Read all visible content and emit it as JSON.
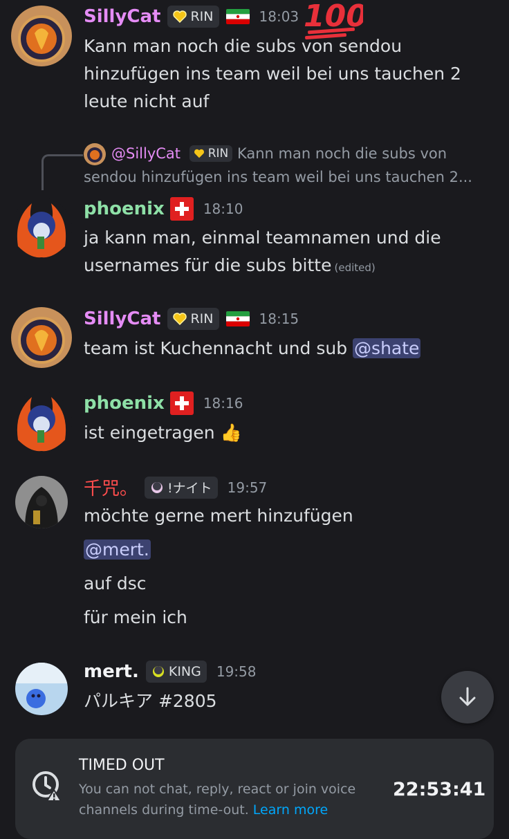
{
  "messages": [
    {
      "author": "SillyCat",
      "tag": "RIN",
      "time": "18:03",
      "lines": [
        "Kann man noch die subs von sendou",
        "hinzufügen ins team weil bei uns tauchen 2",
        "leute nicht auf"
      ]
    },
    {
      "reply": {
        "author": "@SillyCat",
        "tag": "RIN",
        "text_line1": "Kann man noch die subs von",
        "text_line2": "sendou hinzufügen ins team weil bei uns tauchen 2..."
      },
      "author": "phoenix",
      "time": "18:10",
      "lines": [
        "ja kann man, einmal teamnamen und die",
        "usernames für die subs bitte"
      ],
      "edited": "(edited)"
    },
    {
      "author": "SillyCat",
      "tag": "RIN",
      "time": "18:15",
      "text": "team ist Kuchennacht und sub",
      "mention": "@shate"
    },
    {
      "author": "phoenix",
      "time": "18:16",
      "text": "ist eingetragen",
      "emoji": "👍"
    },
    {
      "author": "千咒。",
      "tag": "!ナイト",
      "time": "19:57",
      "lines": [
        "möchte gerne mert hinzufügen"
      ],
      "mention": "@mert.",
      "extra_lines": [
        "auf dsc",
        "für mein ich"
      ]
    },
    {
      "author": "mert.",
      "tag": "KING",
      "time": "19:58",
      "text": "パルキア #2805"
    }
  ],
  "timeout": {
    "title": "TIMED OUT",
    "desc": "You can not chat, reply, react or join voice channels during time-out.",
    "link": "Learn more",
    "countdown": "22:53:41"
  },
  "colors": {
    "background": "#1a1a1e",
    "sillycat_name": "#e58cf5",
    "phoenix_name": "#8ee0a7",
    "senju_name": "#ff4d4d",
    "mert_name": "#f2f3f5",
    "mention_bg": "#3c4270",
    "link": "#00a8fc"
  },
  "icons": [
    "heart-badge-icon",
    "iran-flag-icon",
    "swiss-flag-icon",
    "hundred-points-emoji",
    "moon-badge-icon",
    "crown-badge-icon",
    "arrow-down-icon",
    "timeout-clock-icon"
  ]
}
